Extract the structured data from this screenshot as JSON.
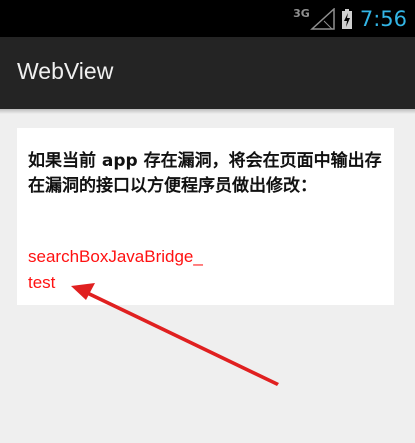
{
  "status_bar": {
    "network_label": "3G",
    "time": "7:56",
    "icons": [
      "signal-icon",
      "battery-icon"
    ],
    "time_color": "#33b5e5"
  },
  "action_bar": {
    "title": "WebView"
  },
  "webview": {
    "message": "如果当前 app 存在漏洞，将会在页面中输出存在漏洞的接口以方便程序员做出修改：",
    "result_line1": "searchBoxJavaBridge_",
    "result_line2": "test",
    "result_color": "#ff1111"
  },
  "annotation": {
    "arrow_color": "#e02020"
  }
}
